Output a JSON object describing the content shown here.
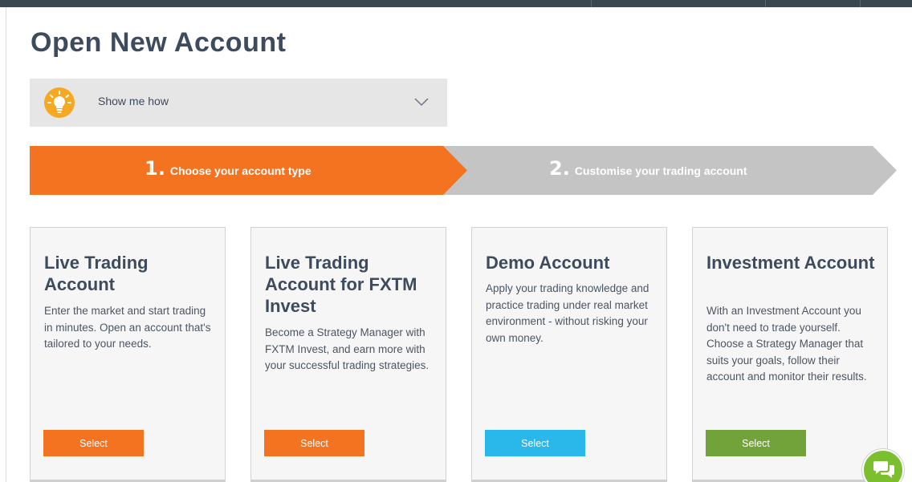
{
  "page": {
    "title": "Open New Account"
  },
  "howto": {
    "label": "Show me how",
    "icon": "lightbulb-icon",
    "chevron": "chevron-down-icon"
  },
  "steps": [
    {
      "number": "1.",
      "label": "Choose your account type",
      "active": true,
      "color": "#f37321"
    },
    {
      "number": "2.",
      "label": "Customise your trading account",
      "active": false,
      "color": "#c4c4c4"
    }
  ],
  "cards": [
    {
      "title": "Live Trading Account",
      "description": "Enter the market and start trading in minutes. Open an account that's tailored to your needs.",
      "button": "Select",
      "button_color": "#f37321"
    },
    {
      "title": "Live Trading Account for FXTM Invest",
      "description": "Become a Strategy Manager with FXTM Invest, and earn more with your successful trading strategies.",
      "button": "Select",
      "button_color": "#f37321"
    },
    {
      "title": "Demo Account",
      "description": "Apply your trading knowledge and practice trading under real market environment - without risking your own money.",
      "button": "Select",
      "button_color": "#2ab7ea"
    },
    {
      "title": "Investment Account",
      "description": "With an Investment Account you don't need to trade yourself. Choose a Strategy Manager that suits your goals, follow their account and monitor their results.",
      "button": "Select",
      "button_color": "#72a33a"
    }
  ],
  "chat": {
    "icon": "chat-bubbles-icon",
    "color": "#7bbf2e"
  }
}
